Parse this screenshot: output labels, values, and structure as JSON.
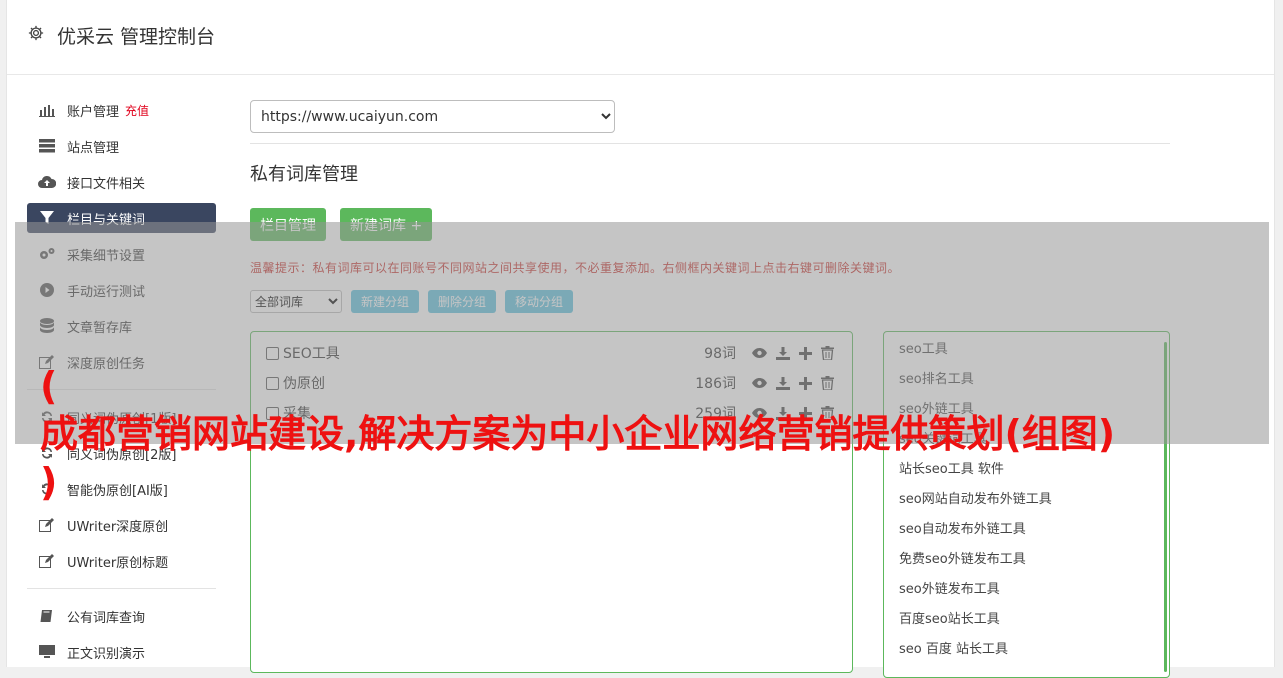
{
  "header": {
    "title": "优采云 管理控制台"
  },
  "sidebar": {
    "items": [
      {
        "label": "账户管理",
        "badge": "充值",
        "icon": "bar-chart-icon"
      },
      {
        "label": "站点管理",
        "icon": "server-icon"
      },
      {
        "label": "接口文件相关",
        "icon": "cloud-upload-icon"
      },
      {
        "label": "栏目与关键词",
        "icon": "filter-icon",
        "active": true
      },
      {
        "label": "采集细节设置",
        "icon": "gears-icon"
      },
      {
        "label": "手动运行测试",
        "icon": "play-icon"
      },
      {
        "label": "文章暂存库",
        "icon": "database-icon"
      },
      {
        "label": "深度原创任务",
        "icon": "edit-icon"
      }
    ],
    "items2": [
      {
        "label": "同义词伪原创[1版]",
        "icon": "refresh-icon"
      },
      {
        "label": "同义词伪原创[2版]",
        "icon": "refresh-icon"
      },
      {
        "label": "智能伪原创[AI版]",
        "icon": "refresh-icon"
      },
      {
        "label": "UWriter深度原创",
        "icon": "edit-icon"
      },
      {
        "label": "UWriter原创标题",
        "icon": "edit-icon"
      }
    ],
    "items3": [
      {
        "label": "公有词库查询",
        "icon": "book-icon"
      },
      {
        "label": "正文识别演示",
        "icon": "monitor-icon"
      }
    ]
  },
  "main": {
    "site_select": "https://www.ucaiyun.com",
    "section_title": "私有词库管理",
    "btn_columns": "栏目管理",
    "btn_new_lib": "新建词库 +",
    "tip": "温馨提示：私有词库可以在同账号不同网站之间共享使用，不必重复添加。右侧框内关键词上点击右键可删除关键词。",
    "filter_select": "全部词库",
    "btn_new_group": "新建分组",
    "btn_delete_group": "删除分组",
    "btn_move_group": "移动分组",
    "groups": [
      {
        "name": "SEO工具",
        "count": "98词"
      },
      {
        "name": "伪原创",
        "count": "186词"
      },
      {
        "name": "采集",
        "count": "259词"
      }
    ],
    "keywords": [
      "seo工具",
      "seo排名工具",
      "seo外链工具",
      "seo关键词工具",
      "站长seo工具 软件",
      "seo网站自动发布外链工具",
      "seo自动发布外链工具",
      "免费seo外链发布工具",
      "seo外链发布工具",
      "百度seo站长工具",
      "seo 百度 站长工具"
    ]
  },
  "overlay": {
    "headline_line1": "(",
    "headline_line2": "成都营销网站建设,解决方案为中小企业网络营销提供策划(组图)",
    "headline_line3": ")"
  },
  "colors": {
    "accent": "#5cb85c",
    "active_nav": "#3a4660",
    "tip": "#c9302c",
    "headline": "#ee1111"
  }
}
